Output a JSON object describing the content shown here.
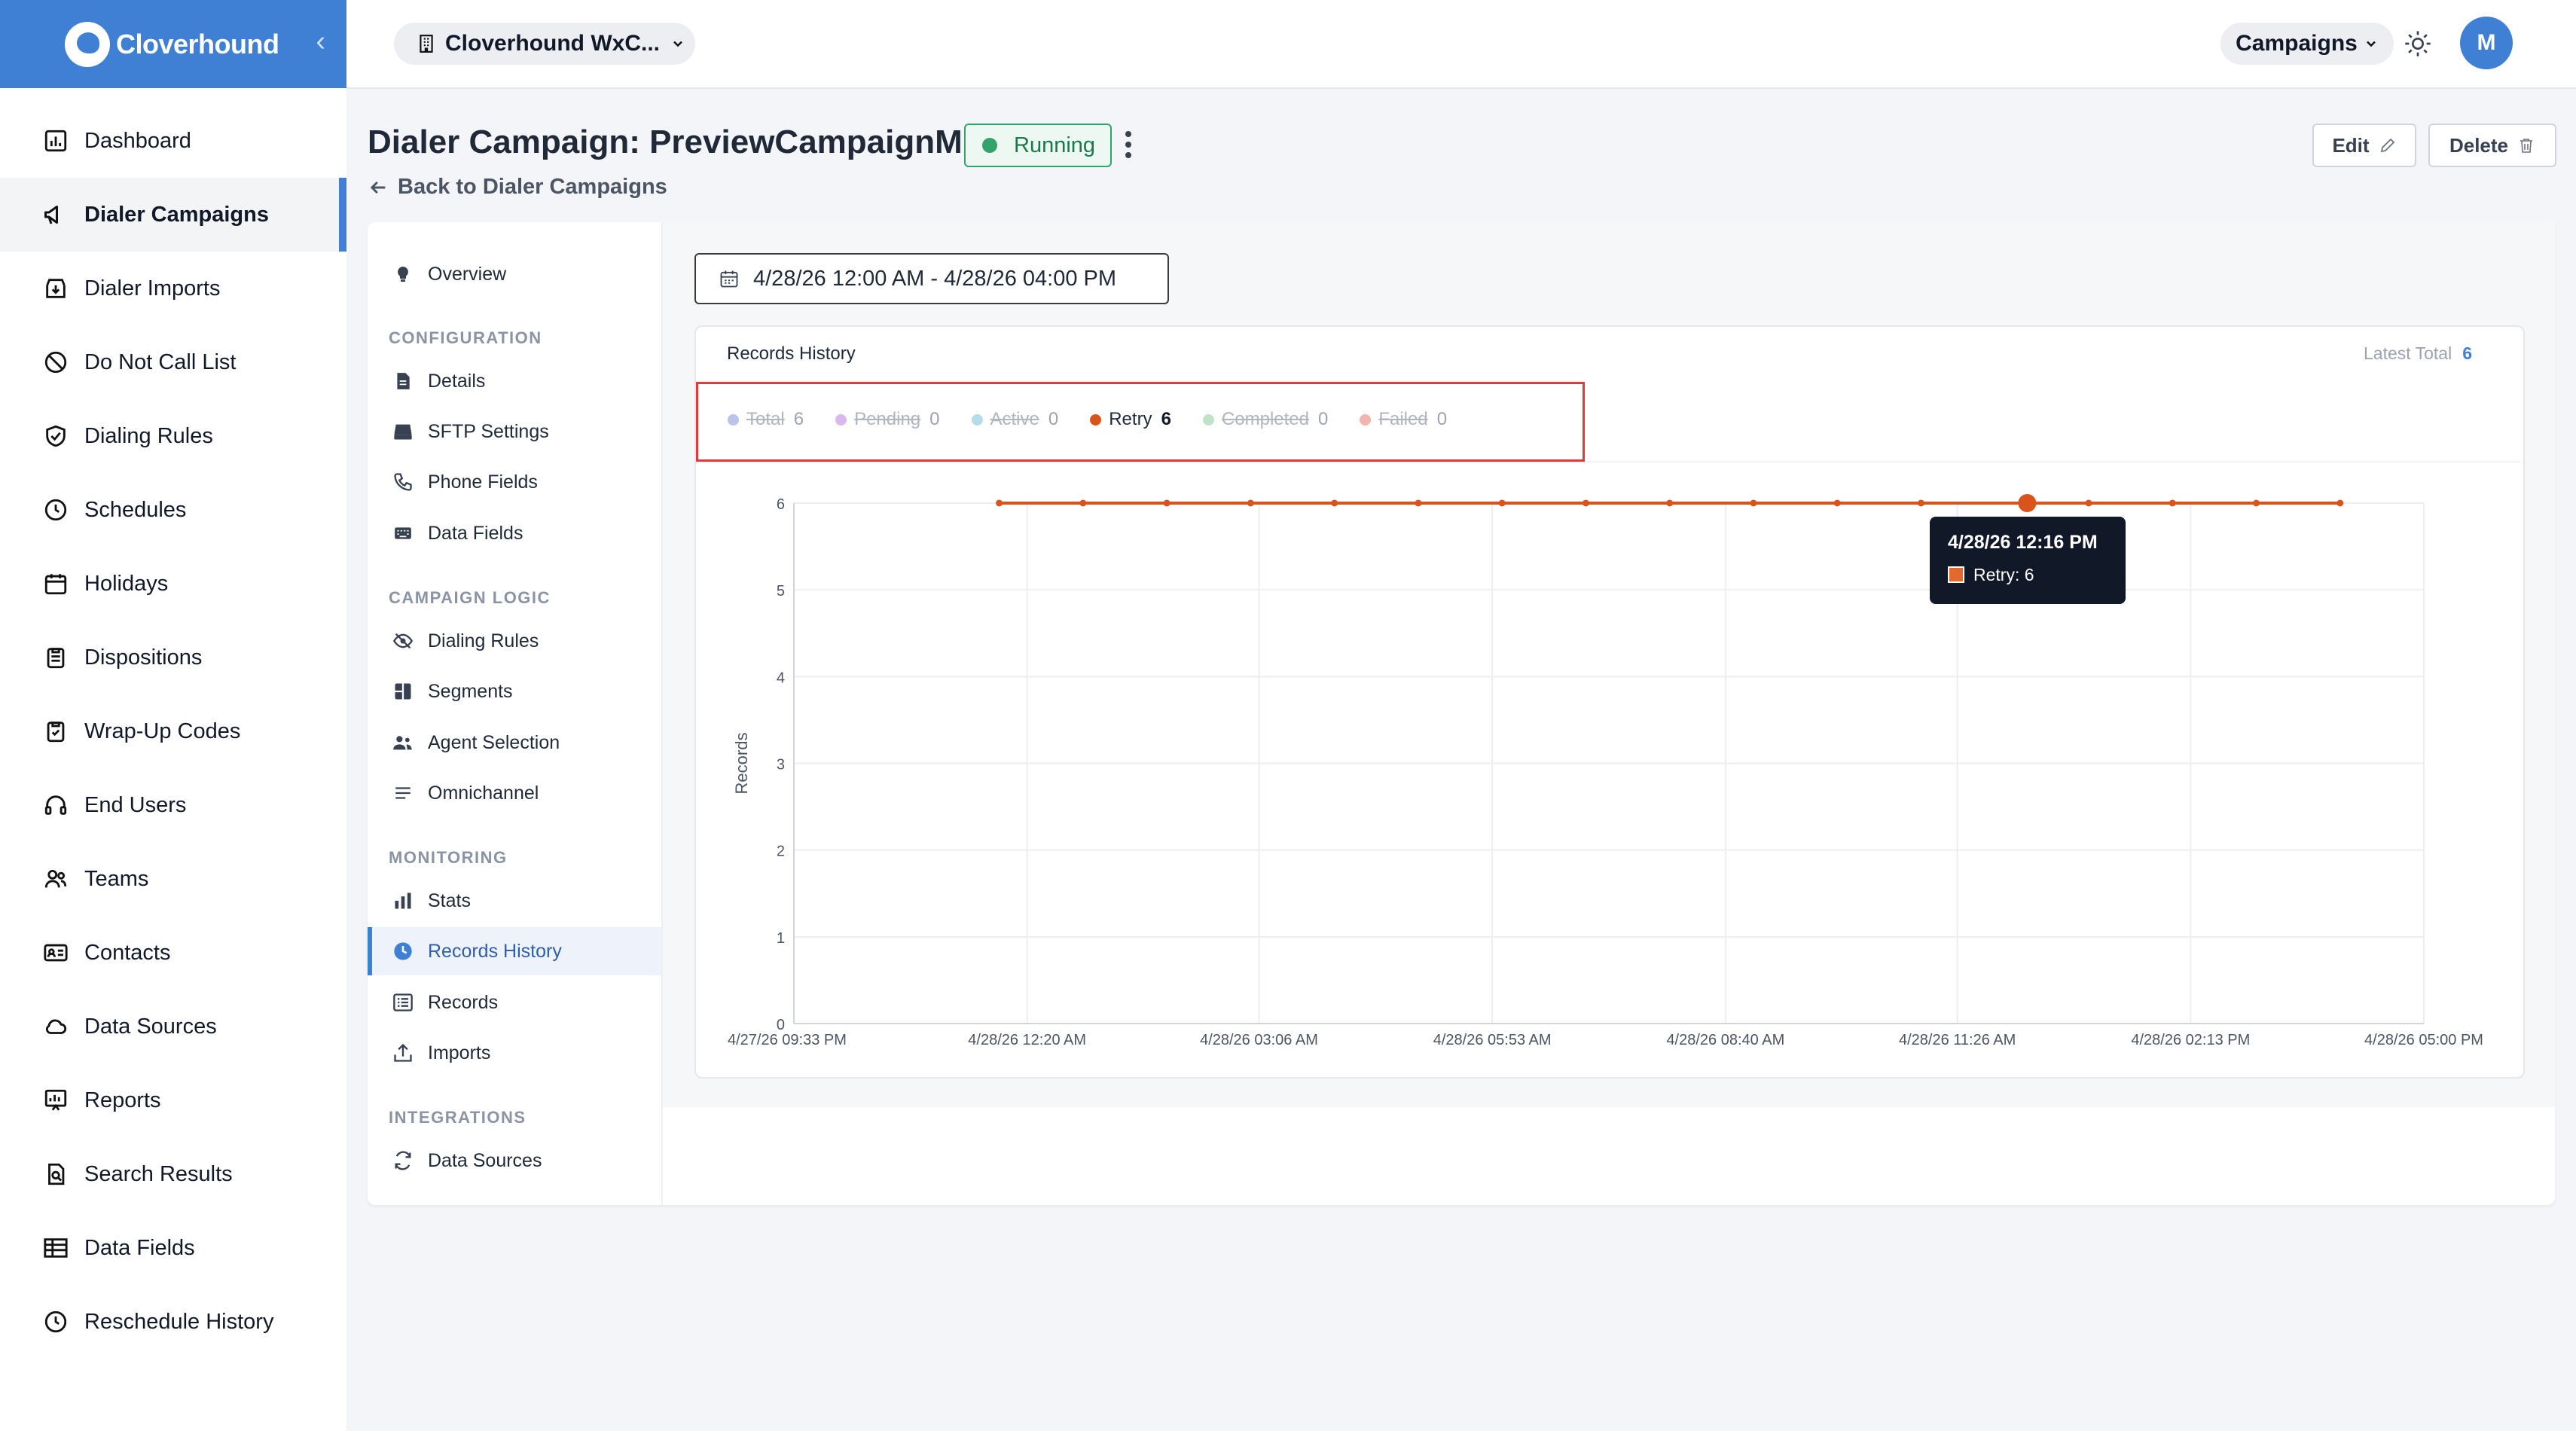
{
  "brand": {
    "name": "Cloverhound"
  },
  "sidebar": {
    "items": [
      {
        "label": "Dashboard",
        "icon": "chart-box-icon"
      },
      {
        "label": "Dialer Campaigns",
        "icon": "megaphone-icon",
        "active": true
      },
      {
        "label": "Dialer Imports",
        "icon": "import-box-icon"
      },
      {
        "label": "Do Not Call List",
        "icon": "block-icon"
      },
      {
        "label": "Dialing Rules",
        "icon": "shield-check-icon"
      },
      {
        "label": "Schedules",
        "icon": "clock-icon"
      },
      {
        "label": "Holidays",
        "icon": "calendar-icon"
      },
      {
        "label": "Dispositions",
        "icon": "clipboard-icon"
      },
      {
        "label": "Wrap-Up Codes",
        "icon": "clipboard-check-icon"
      },
      {
        "label": "End Users",
        "icon": "headset-icon"
      },
      {
        "label": "Teams",
        "icon": "users-icon"
      },
      {
        "label": "Contacts",
        "icon": "contact-card-icon"
      },
      {
        "label": "Data Sources",
        "icon": "cloud-icon"
      },
      {
        "label": "Reports",
        "icon": "report-icon"
      },
      {
        "label": "Search Results",
        "icon": "search-doc-icon"
      },
      {
        "label": "Data Fields",
        "icon": "table-icon"
      },
      {
        "label": "Reschedule History",
        "icon": "clock-icon"
      }
    ]
  },
  "topbar": {
    "workspace": "Cloverhound WxC...",
    "module": "Campaigns",
    "avatar_initial": "M"
  },
  "header": {
    "title": "Dialer Campaign: PreviewCampaignM",
    "status": "Running",
    "back": "Back to Dialer Campaigns",
    "edit": "Edit",
    "delete": "Delete"
  },
  "subnav": {
    "overview": "Overview",
    "sections": [
      {
        "heading": "CONFIGURATION",
        "items": [
          "Details",
          "SFTP Settings",
          "Phone Fields",
          "Data Fields"
        ]
      },
      {
        "heading": "CAMPAIGN LOGIC",
        "items": [
          "Dialing Rules",
          "Segments",
          "Agent Selection",
          "Omnichannel"
        ]
      },
      {
        "heading": "MONITORING",
        "items": [
          "Stats",
          "Records History",
          "Records",
          "Imports"
        ]
      },
      {
        "heading": "INTEGRATIONS",
        "items": [
          "Data Sources"
        ]
      }
    ],
    "active": "Records History"
  },
  "filter": {
    "date_range": "4/28/26 12:00 AM - 4/28/26 04:00 PM"
  },
  "chart_card": {
    "title": "Records History",
    "latest_label": "Latest Total",
    "latest_value": "6",
    "legend": [
      {
        "name": "Total",
        "count": "6",
        "color": "#b9c4e8",
        "enabled": false
      },
      {
        "name": "Pending",
        "count": "0",
        "color": "#d7b8ef",
        "enabled": false
      },
      {
        "name": "Active",
        "count": "0",
        "color": "#b6dcec",
        "enabled": false
      },
      {
        "name": "Retry",
        "count": "6",
        "color": "#d9541c",
        "enabled": true
      },
      {
        "name": "Completed",
        "count": "0",
        "color": "#bfe3c6",
        "enabled": false
      },
      {
        "name": "Failed",
        "count": "0",
        "color": "#f2b5ad",
        "enabled": false
      }
    ],
    "tooltip": {
      "title": "4/28/26 12:16 PM",
      "text": "Retry: 6"
    }
  },
  "chart_data": {
    "type": "line",
    "ylabel": "Records",
    "ylim": [
      0,
      6
    ],
    "yticks": [
      "0",
      "1",
      "2",
      "3",
      "4",
      "5",
      "6"
    ],
    "xticks": [
      "4/27/26 09:33 PM",
      "4/28/26 12:20 AM",
      "4/28/26 03:06 AM",
      "4/28/26 05:53 AM",
      "4/28/26 08:40 AM",
      "4/28/26 11:26 AM",
      "4/28/26 02:13 PM",
      "4/28/26 05:00 PM"
    ],
    "xrange": [
      "4/27/26 09:33 PM",
      "4/28/26 05:00 PM"
    ],
    "grid": true,
    "series": [
      {
        "name": "Retry",
        "color": "#d9541c",
        "x": [
          "4/28/26 12:00 AM",
          "4/28/26 01:00 AM",
          "4/28/26 02:00 AM",
          "4/28/26 03:00 AM",
          "4/28/26 04:00 AM",
          "4/28/26 05:00 AM",
          "4/28/26 06:00 AM",
          "4/28/26 07:00 AM",
          "4/28/26 08:00 AM",
          "4/28/26 09:00 AM",
          "4/28/26 10:00 AM",
          "4/28/26 11:00 AM",
          "4/28/26 12:16 PM",
          "4/28/26 01:00 PM",
          "4/28/26 02:00 PM",
          "4/28/26 03:00 PM",
          "4/28/26 04:00 PM"
        ],
        "values": [
          6,
          6,
          6,
          6,
          6,
          6,
          6,
          6,
          6,
          6,
          6,
          6,
          6,
          6,
          6,
          6,
          6
        ]
      }
    ]
  }
}
